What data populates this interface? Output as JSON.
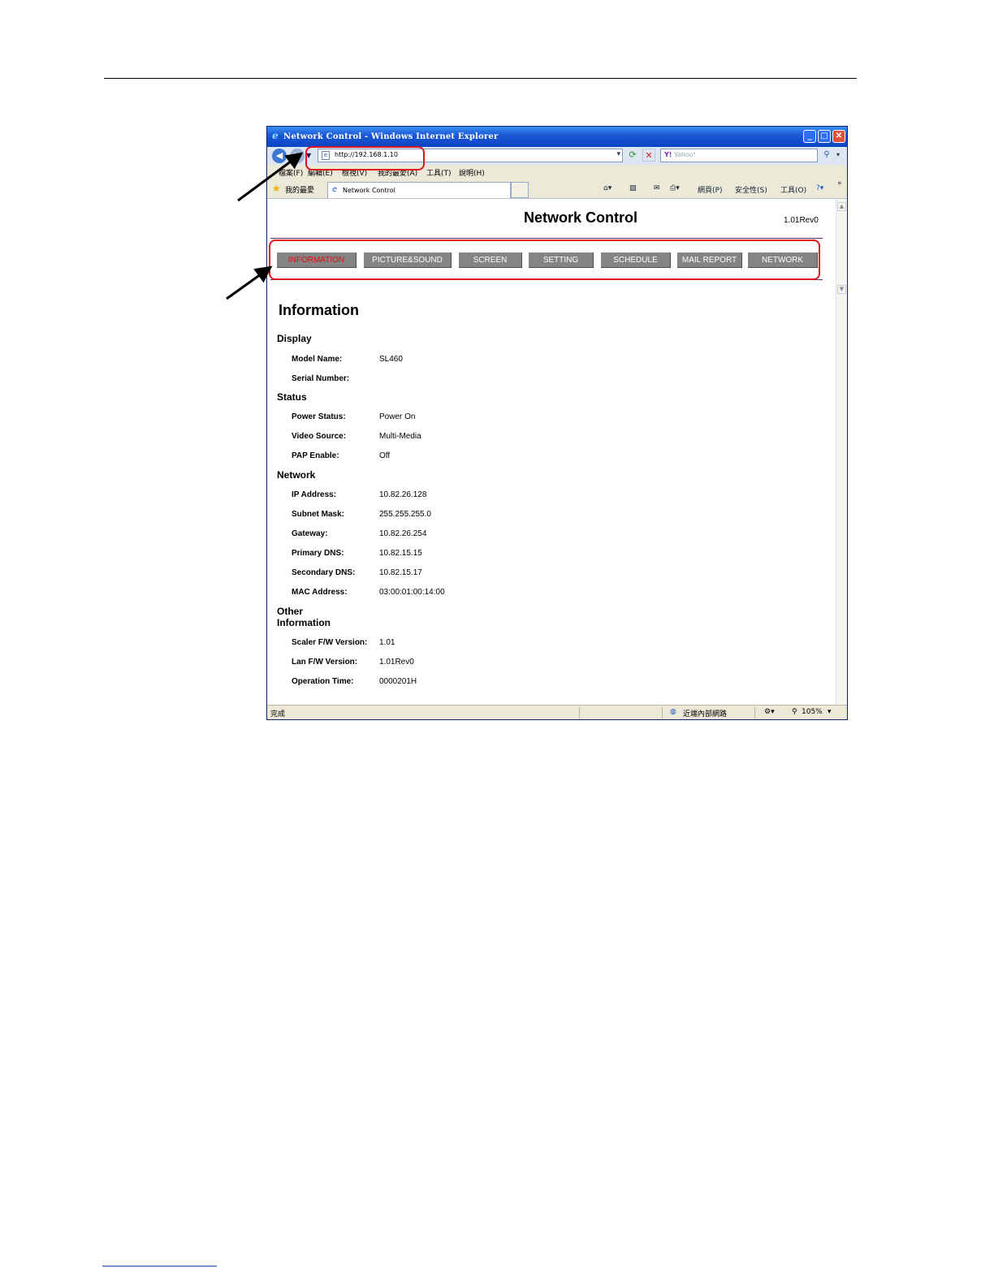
{
  "window": {
    "title": "Network Control - Windows Internet Explorer",
    "url": "http://192.168.1.10",
    "search_placeholder": "Yahoo!",
    "menu": [
      "檔案(F)",
      "編輯(E)",
      "檢視(V)",
      "我的最愛(A)",
      "工具(T)",
      "說明(H)"
    ],
    "favorites_label": "我的最愛",
    "tab_label": "Network Control",
    "tools": {
      "page": "網頁(P)",
      "safety": "安全性(S)",
      "tools": "工具(O)"
    },
    "status": {
      "left": "完成",
      "zone": "近端內部網路",
      "zoom": "105%"
    }
  },
  "page": {
    "title": "Network Control",
    "version": "1.01Rev0",
    "nav": [
      "INFORMATION",
      "PICTURE&SOUND",
      "SCREEN",
      "SETTING",
      "SCHEDULE",
      "MAIL REPORT",
      "NETWORK"
    ],
    "heading": "Information",
    "display": {
      "title": "Display",
      "model_name_label": "Model Name:",
      "model_name": "SL460",
      "serial_label": "Serial Number:",
      "serial": ""
    },
    "status": {
      "title": "Status",
      "power_label": "Power Status:",
      "power": "Power On",
      "source_label": "Video Source:",
      "source": "Multi-Media",
      "pap_label": "PAP Enable:",
      "pap": "Off"
    },
    "network": {
      "title": "Network",
      "ip_label": "IP Address:",
      "ip": "10.82.26.128",
      "mask_label": "Subnet Mask:",
      "mask": "255.255.255.0",
      "gw_label": "Gateway:",
      "gw": "10.82.26.254",
      "dns1_label": "Primary DNS:",
      "dns1": "10.82.15.15",
      "dns2_label": "Secondary DNS:",
      "dns2": "10.82.15.17",
      "mac_label": "MAC Address:",
      "mac": "03:00:01:00:14:00"
    },
    "other": {
      "title_line1": "Other",
      "title_line2": "Information",
      "scaler_label": "Scaler F/W Version:",
      "scaler": "1.01",
      "lan_label": "Lan F/W Version:",
      "lan": "1.01Rev0",
      "optime_label": "Operation Time:",
      "optime": "0000201H"
    }
  },
  "colors": {
    "highlight": "#e0141e",
    "nav_button": "#848484",
    "active_nav_text": "#e10d0d",
    "titlebar": "#1957d3"
  }
}
